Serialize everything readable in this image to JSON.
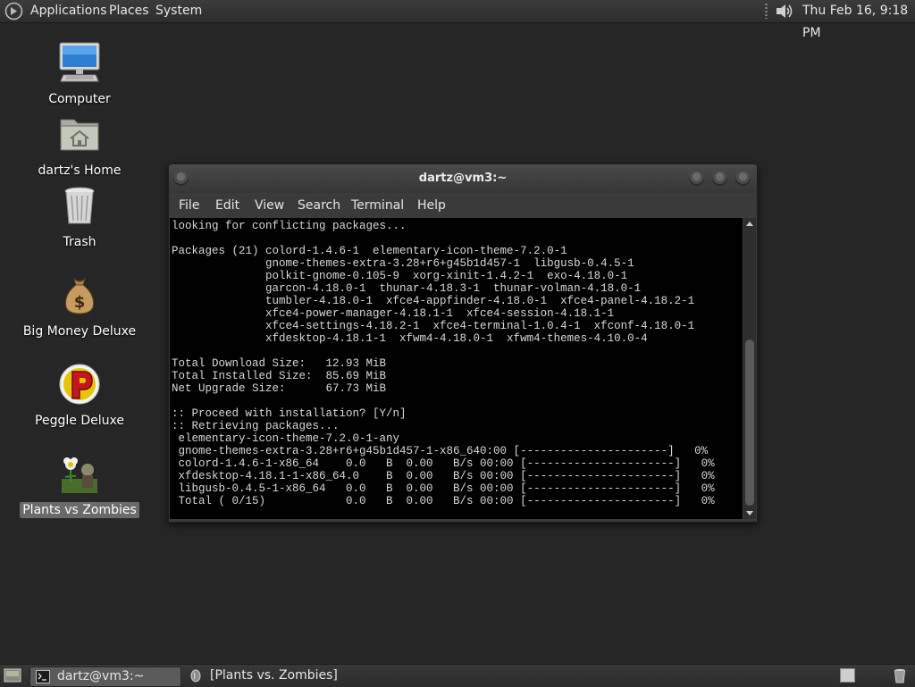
{
  "top_panel": {
    "menus": [
      "Applications",
      "Places",
      "System"
    ],
    "clock": "Thu Feb 16,  9:18 PM"
  },
  "desktop": {
    "icons": [
      {
        "label": "Computer",
        "icon": "computer-icon"
      },
      {
        "label": "dartz's Home",
        "icon": "home-folder-icon"
      },
      {
        "label": "Trash",
        "icon": "trash-icon"
      },
      {
        "label": "Big Money Deluxe",
        "icon": "money-bag-icon"
      },
      {
        "label": "Peggle Deluxe",
        "icon": "peggle-icon"
      },
      {
        "label": "Plants vs Zombies",
        "icon": "plants-vs-zombies-icon",
        "selected": true
      }
    ]
  },
  "terminal": {
    "title": "dartz@vm3:~",
    "menu": [
      "File",
      "Edit",
      "View",
      "Search",
      "Terminal",
      "Help"
    ],
    "lines": [
      "looking for conflicting packages...",
      "",
      "Packages (21) colord-1.4.6-1  elementary-icon-theme-7.2.0-1",
      "              gnome-themes-extra-3.28+r6+g45b1d457-1  libgusb-0.4.5-1",
      "              polkit-gnome-0.105-9  xorg-xinit-1.4.2-1  exo-4.18.0-1",
      "              garcon-4.18.0-1  thunar-4.18.3-1  thunar-volman-4.18.0-1",
      "              tumbler-4.18.0-1  xfce4-appfinder-4.18.0-1  xfce4-panel-4.18.2-1",
      "              xfce4-power-manager-4.18.1-1  xfce4-session-4.18.1-1",
      "              xfce4-settings-4.18.2-1  xfce4-terminal-1.0.4-1  xfconf-4.18.0-1",
      "              xfdesktop-4.18.1-1  xfwm4-4.18.0-1  xfwm4-themes-4.10.0-4",
      "",
      "Total Download Size:   12.93 MiB",
      "Total Installed Size:  85.69 MiB",
      "Net Upgrade Size:      67.73 MiB",
      "",
      ":: Proceed with installation? [Y/n]",
      ":: Retrieving packages...",
      " elementary-icon-theme-7.2.0-1-any",
      " gnome-themes-extra-3.28+r6+g45b1d457-1-x86_640:00 [----------------------]   0%",
      " colord-1.4.6-1-x86_64    0.0   B  0.00   B/s 00:00 [----------------------]   0%",
      " xfdesktop-4.18.1-1-x86_64.0    B  0.00   B/s 00:00 [----------------------]   0%",
      " libgusb-0.4.5-1-x86_64   0.0   B  0.00   B/s 00:00 [----------------------]   0%",
      " Total ( 0/15)            0.0   B  0.00   B/s 00:00 [----------------------]   0%"
    ]
  },
  "taskbar": {
    "tasks": [
      {
        "label": "dartz@vm3:~",
        "icon": "terminal-icon",
        "active": true
      },
      {
        "label": "[Plants vs. Zombies]",
        "icon": "wine-icon",
        "active": false
      }
    ]
  }
}
